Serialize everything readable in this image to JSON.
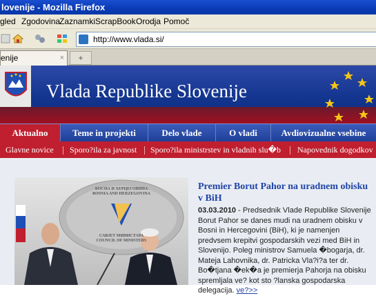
{
  "window": {
    "title": "lovenije - Mozilla Firefox"
  },
  "menu": [
    "gled",
    "Zgodovina",
    "Zaznamki",
    "ScrapBook",
    "Orodja",
    "Pomoč"
  ],
  "url": "http://www.vlada.si/",
  "tab": {
    "label": "enije",
    "close": "×",
    "new": "+"
  },
  "site": {
    "title": "Vlada Republike Slovenije",
    "nav": [
      "Aktualno",
      "Teme in projekti",
      "Delo vlade",
      "O vladi",
      "Avdiovizualne vsebine"
    ],
    "subnav": [
      "Glavne novice",
      "Sporo?ila za javnost",
      "Sporo?ila ministrstev in vladnih slu�b",
      "Napovednik dogodkov"
    ]
  },
  "article": {
    "headline": "Premier Borut Pahor na uradnem obisku v BiH",
    "date": "03.03.2010",
    "text": " - Predsednik Vlade Republike Slovenije Borut Pahor se danes mudi na uradnem obisku v Bosni in Hercegovini (BiH), ki je namenjen predvsem krepitvi gospodarskih vezi med BiH in Slovenijo. Poleg ministrov Samuela �bogarja, dr. Mateja Lahovnika, dr. Patricka Vla?i?a ter dr. Bo�tjana �ek�a je premierja Pahorja na obisku spremljala ve? kot sto ?lanska gospodarska delegacija. ",
    "more": "ve?>>"
  },
  "photo_sign": [
    "БОСНА И ХЕРЦЕГОВИНА",
    "BOSNIA AND HERZEGOVINA",
    "САВЈЕТ МИНИСТАРА",
    "COUNCIL OF MINISTERS"
  ]
}
